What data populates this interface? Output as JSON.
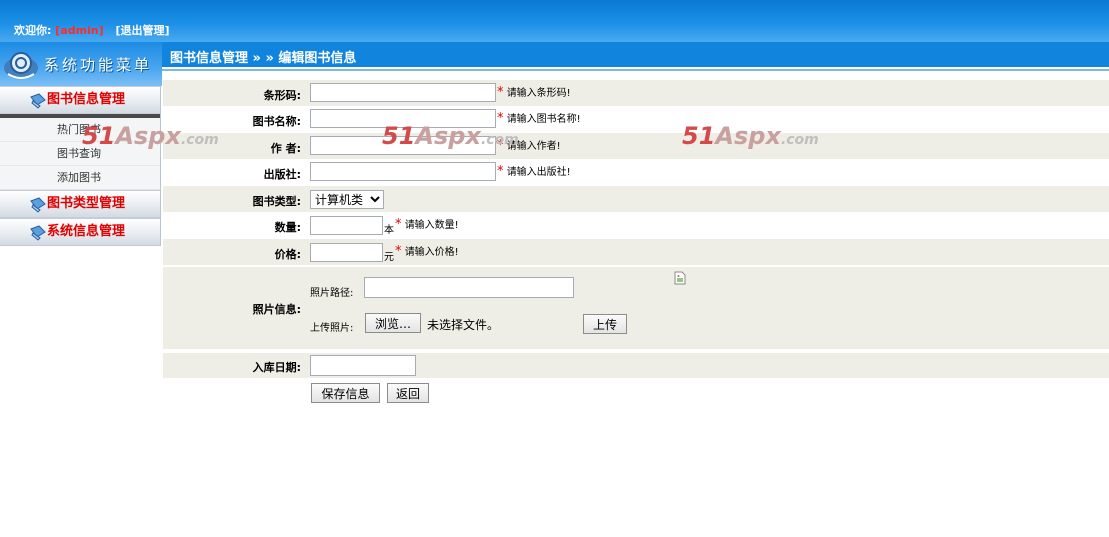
{
  "header": {
    "welcome_label": "欢迎你:",
    "username": "[admin]",
    "logout_label": "[退出管理]"
  },
  "sidebar": {
    "banner_title": "系统功能菜单",
    "sections": [
      {
        "label": "图书信息管理",
        "items": [
          "热门图书",
          "图书查询",
          "添加图书"
        ]
      },
      {
        "label": "图书类型管理"
      },
      {
        "label": "系统信息管理"
      }
    ]
  },
  "breadcrumb": "图书信息管理 » » 编辑图书信息",
  "form": {
    "barcode": {
      "label": "条形码:",
      "value": "",
      "hint": "请输入条形码!"
    },
    "book_name": {
      "label": "图书名称:",
      "value": "",
      "hint": "请输入图书名称!"
    },
    "author": {
      "label": "作 者:",
      "value": "",
      "hint": "请输入作者!"
    },
    "publisher": {
      "label": "出版社:",
      "value": "",
      "hint": "请输入出版社!"
    },
    "book_type": {
      "label": "图书类型:",
      "selected": "计算机类"
    },
    "quantity": {
      "label": "数量:",
      "value": "",
      "unit": "本",
      "hint": "请输入数量!"
    },
    "price": {
      "label": "价格:",
      "value": "",
      "unit": "元",
      "hint": "请输入价格!"
    },
    "photo": {
      "label": "照片信息:",
      "path_label": "照片路径:",
      "path_value": "",
      "upload_label": "上传照片:",
      "browse_label": "浏览…",
      "no_file_label": "未选择文件。",
      "upload_button": "上传"
    },
    "in_date": {
      "label": "入库日期:",
      "value": ""
    },
    "required_mark": "*",
    "save_button": "保存信息",
    "back_button": "返回"
  },
  "watermark": {
    "num": "51",
    "asp": "Aspx",
    "dom": ".com"
  },
  "colors": {
    "header_blue": "#1184dd",
    "required_red": "#e00000",
    "row_bg": "#efeee6"
  },
  "icons": [
    "book-menu-icon",
    "broken-image-icon",
    "system-logo-icon"
  ]
}
